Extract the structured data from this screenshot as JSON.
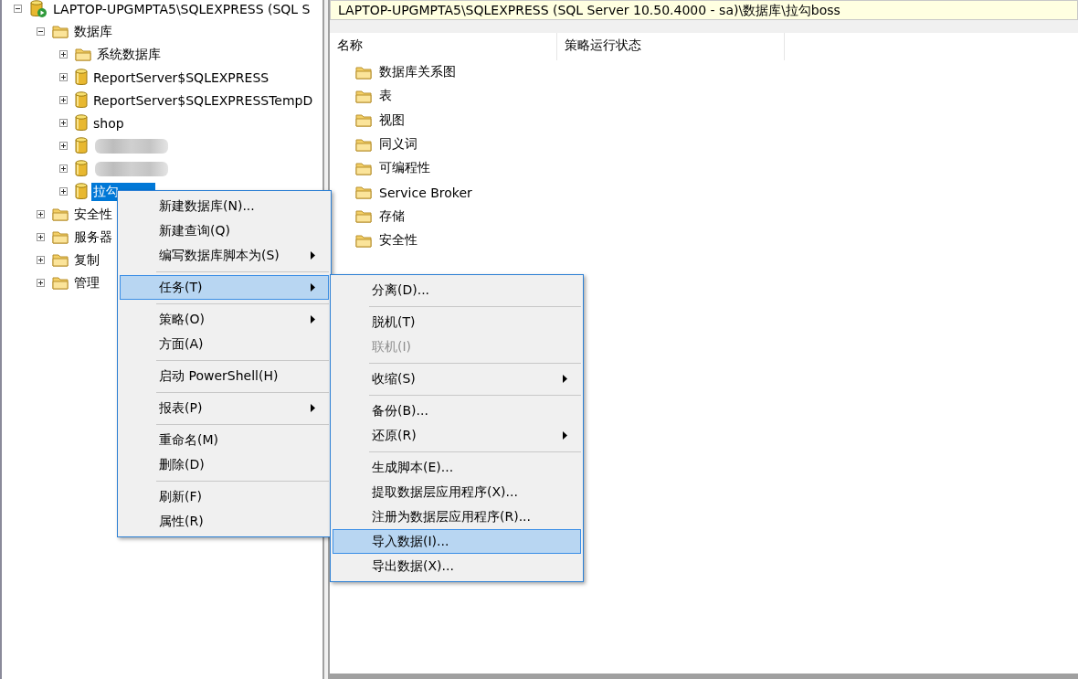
{
  "tree": {
    "label": "LAPTOP-UPGMPTA5\\SQLEXPRESS (SQL S",
    "kind": "server",
    "expanded": true,
    "selected": false,
    "children": [
      {
        "label": "数据库",
        "kind": "folder",
        "expanded": true,
        "selected": false,
        "children": [
          {
            "label": "系统数据库",
            "kind": "folder",
            "expanded": false,
            "selected": false
          },
          {
            "label": "ReportServer$SQLEXPRESS",
            "kind": "database",
            "expanded": false,
            "selected": false
          },
          {
            "label": "ReportServer$SQLEXPRESSTempD",
            "kind": "database",
            "expanded": false,
            "selected": false
          },
          {
            "label": "shop",
            "kind": "database",
            "expanded": false,
            "selected": false
          },
          {
            "kind": "database",
            "expanded": false,
            "selected": false
          },
          {
            "kind": "database",
            "expanded": false,
            "selected": false
          },
          {
            "label": "拉勾",
            "kind": "database",
            "expanded": false,
            "selected": true
          }
        ]
      },
      {
        "label": "安全性",
        "kind": "folder",
        "expanded": false,
        "selected": false
      },
      {
        "label": "服务器",
        "kind": "folder",
        "expanded": false,
        "selected": false
      },
      {
        "label": "复制",
        "kind": "folder",
        "expanded": false,
        "selected": false
      },
      {
        "label": "管理",
        "kind": "folder",
        "expanded": false,
        "selected": false
      }
    ]
  },
  "address_bar": {
    "text": "LAPTOP-UPGMPTA5\\SQLEXPRESS (SQL Server 10.50.4000 - sa)\\数据库\\拉勾boss"
  },
  "details": {
    "columns": [
      "名称",
      "策略运行状态"
    ],
    "items": [
      "数据库关系图",
      "表",
      "视图",
      "同义词",
      "可编程性",
      "Service Broker",
      "存储",
      "安全性"
    ]
  },
  "context_menu": [
    {
      "kind": "item",
      "label": "新建数据库(N)...",
      "selected": false,
      "submenu": false
    },
    {
      "kind": "item",
      "label": "新建查询(Q)",
      "selected": false,
      "submenu": false
    },
    {
      "kind": "item",
      "label": "编写数据库脚本为(S)",
      "selected": false,
      "submenu": true
    },
    {
      "kind": "separator"
    },
    {
      "kind": "item",
      "label": "任务(T)",
      "selected": true,
      "submenu": true
    },
    {
      "kind": "separator"
    },
    {
      "kind": "item",
      "label": "策略(O)",
      "selected": false,
      "submenu": true
    },
    {
      "kind": "item",
      "label": "方面(A)",
      "selected": false,
      "submenu": false
    },
    {
      "kind": "separator"
    },
    {
      "kind": "item",
      "label": "启动 PowerShell(H)",
      "selected": false,
      "submenu": false
    },
    {
      "kind": "separator"
    },
    {
      "kind": "item",
      "label": "报表(P)",
      "selected": false,
      "submenu": true
    },
    {
      "kind": "separator"
    },
    {
      "kind": "item",
      "label": "重命名(M)",
      "selected": false,
      "submenu": false
    },
    {
      "kind": "item",
      "label": "删除(D)",
      "selected": false,
      "submenu": false
    },
    {
      "kind": "separator"
    },
    {
      "kind": "item",
      "label": "刷新(F)",
      "selected": false,
      "submenu": false
    },
    {
      "kind": "item",
      "label": "属性(R)",
      "selected": false,
      "submenu": false
    }
  ],
  "tasks_submenu": [
    {
      "kind": "item",
      "label": "分离(D)...",
      "selected": false,
      "submenu": false,
      "disabled": false
    },
    {
      "kind": "separator"
    },
    {
      "kind": "item",
      "label": "脱机(T)",
      "selected": false,
      "submenu": false,
      "disabled": false
    },
    {
      "kind": "item",
      "label": "联机(I)",
      "selected": false,
      "submenu": false,
      "disabled": true
    },
    {
      "kind": "separator"
    },
    {
      "kind": "item",
      "label": "收缩(S)",
      "selected": false,
      "submenu": true,
      "disabled": false
    },
    {
      "kind": "separator"
    },
    {
      "kind": "item",
      "label": "备份(B)...",
      "selected": false,
      "submenu": false,
      "disabled": false
    },
    {
      "kind": "item",
      "label": "还原(R)",
      "selected": false,
      "submenu": true,
      "disabled": false
    },
    {
      "kind": "separator"
    },
    {
      "kind": "item",
      "label": "生成脚本(E)...",
      "selected": false,
      "submenu": false,
      "disabled": false
    },
    {
      "kind": "item",
      "label": "提取数据层应用程序(X)...",
      "selected": false,
      "submenu": false,
      "disabled": false
    },
    {
      "kind": "item",
      "label": "注册为数据层应用程序(R)...",
      "selected": false,
      "submenu": false,
      "disabled": false
    },
    {
      "kind": "item",
      "label": "导入数据(I)...",
      "selected": true,
      "submenu": false,
      "disabled": false
    },
    {
      "kind": "item",
      "label": "导出数据(X)...",
      "selected": false,
      "submenu": false,
      "disabled": false
    }
  ]
}
